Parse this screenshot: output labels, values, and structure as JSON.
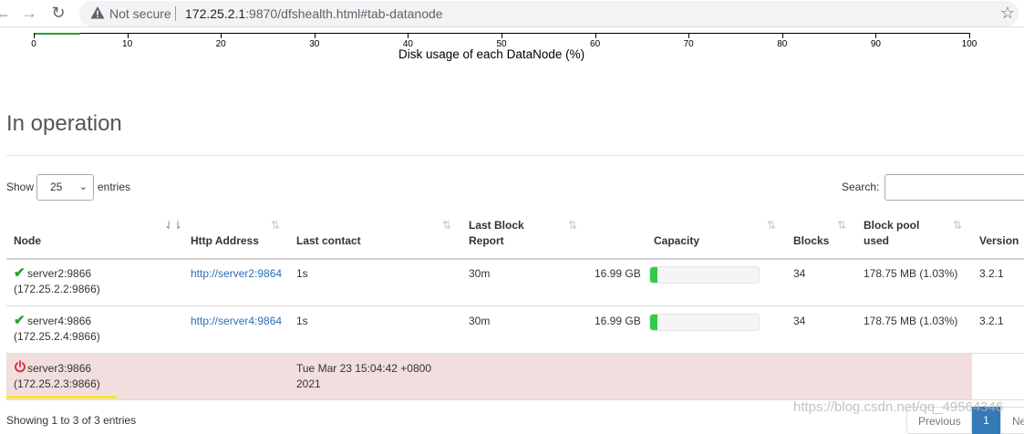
{
  "browser": {
    "security_label": "Not secure",
    "url_host": "172.25.2.1",
    "url_rest": ":9870/dfshealth.html#tab-datanode"
  },
  "histogram": {
    "ticks": [
      "0",
      "10",
      "20",
      "30",
      "40",
      "50",
      "60",
      "70",
      "80",
      "90",
      "100"
    ],
    "xlabel": "Disk usage of each DataNode (%)",
    "bar_fraction": 0.05
  },
  "section": {
    "title": "In operation"
  },
  "controls": {
    "show_label": "Show",
    "page_length": "25",
    "entries_label": "entries",
    "search_label": "Search:"
  },
  "table": {
    "headers": {
      "node": "Node",
      "http": "Http Address",
      "last_contact": "Last contact",
      "block_report_1": "Last Block",
      "block_report_2": "Report",
      "capacity": "Capacity",
      "blocks": "Blocks",
      "pool_1": "Block pool",
      "pool_2": "used",
      "version": "Version"
    },
    "rows": [
      {
        "node_1": "server2:9866",
        "node_2": "(172.25.2.2:9866)",
        "http": "http://server2:9864",
        "last_contact": "1s",
        "block_report": "30m",
        "capacity": "16.99 GB",
        "capacity_used_fraction": 0.07,
        "blocks": "34",
        "pool_used": "178.75 MB (1.03%)",
        "version": "3.2.1"
      },
      {
        "node_1": "server4:9866",
        "node_2": "(172.25.2.4:9866)",
        "http": "http://server4:9864",
        "last_contact": "1s",
        "block_report": "30m",
        "capacity": "16.99 GB",
        "capacity_used_fraction": 0.07,
        "blocks": "34",
        "pool_used": "178.75 MB (1.03%)",
        "version": "3.2.1"
      },
      {
        "node_1": "server3:9866",
        "node_2": "(172.25.2.3:9866)",
        "last_contact_1": "Tue Mar 23 15:04:42 +0800",
        "last_contact_2": "2021"
      }
    ]
  },
  "footer": {
    "info": "Showing 1 to 3 of 3 entries",
    "prev": "Previous",
    "page": "1",
    "next": "Ne"
  },
  "watermark": "https://blog.csdn.net/qq_49564346",
  "colors": {
    "live_check": "#2ca02c",
    "dead_row": "#f2dede",
    "capacity_fill": "#2fcc4a",
    "link": "#2a6ebb"
  }
}
